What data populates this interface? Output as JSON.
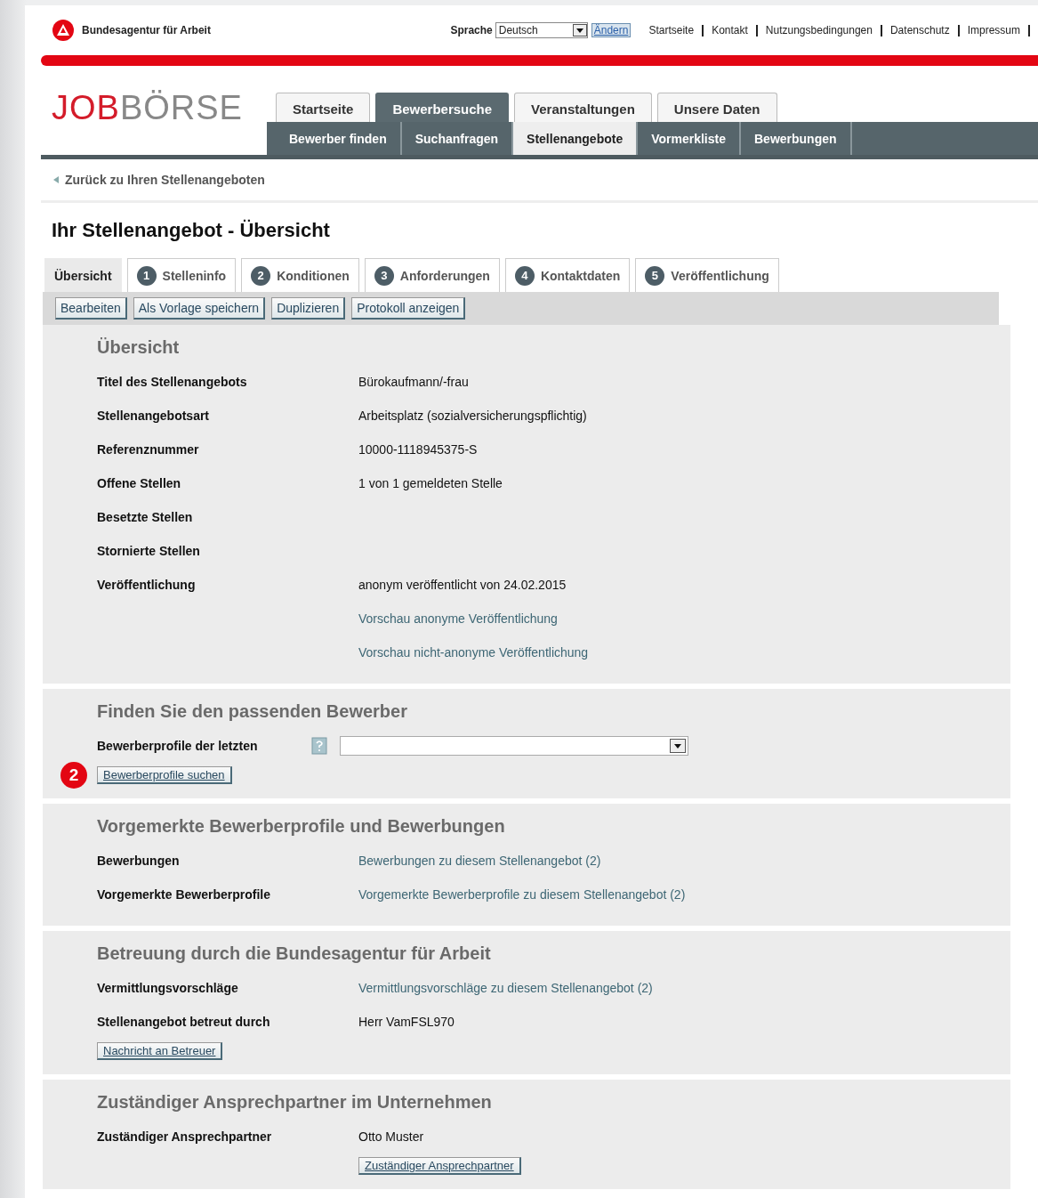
{
  "header": {
    "agency": "Bundesagentur für Arbeit",
    "language_label": "Sprache",
    "language_value": "Deutsch",
    "change_link": "Ändern",
    "top_links": [
      "Startseite",
      "Kontakt",
      "Nutzungsbedingungen",
      "Datenschutz",
      "Impressum"
    ]
  },
  "brand": {
    "part_1": "JOB",
    "part_2": "BÖRSE"
  },
  "main_tabs": [
    {
      "label": "Startseite",
      "selected": false
    },
    {
      "label": "Bewerbersuche",
      "selected": true
    },
    {
      "label": "Veranstaltungen",
      "selected": false
    },
    {
      "label": "Unsere Daten",
      "selected": false
    }
  ],
  "sub_tabs": [
    {
      "label": "Bewerber finden",
      "selected": false
    },
    {
      "label": "Suchanfragen",
      "selected": false
    },
    {
      "label": "Stellenangebote",
      "selected": true
    },
    {
      "label": "Vormerkliste",
      "selected": false
    },
    {
      "label": "Bewerbungen",
      "selected": false
    }
  ],
  "back_link": "Zurück zu Ihren Stellenangeboten",
  "page_title": "Ihr Stellenangebot - Übersicht",
  "step_tabs": [
    {
      "label": "Übersicht",
      "selected": true
    },
    {
      "number": "1",
      "label": "Stelleninfo",
      "selected": false
    },
    {
      "number": "2",
      "label": "Konditionen",
      "selected": false
    },
    {
      "number": "3",
      "label": "Anforderungen",
      "selected": false
    },
    {
      "number": "4",
      "label": "Kontaktdaten",
      "selected": false
    },
    {
      "number": "5",
      "label": "Veröffentlichung",
      "selected": false
    }
  ],
  "action_buttons": [
    "Bearbeiten",
    "Als Vorlage speichern",
    "Duplizieren",
    "Protokoll anzeigen"
  ],
  "sections": [
    {
      "title": "Übersicht",
      "rows": [
        {
          "label": "Titel des Stellenangebots",
          "kind": "text",
          "value": "Bürokaufmann/-frau"
        },
        {
          "label": "Stellenangebotsart",
          "kind": "text",
          "value": "Arbeitsplatz (sozialversicherungspflichtig)"
        },
        {
          "label": "Referenznummer",
          "kind": "text",
          "value": "10000-1118945375-S"
        },
        {
          "label": "Offene Stellen",
          "kind": "text",
          "value": "1 von 1 gemeldeten Stelle"
        },
        {
          "label": "Besetzte Stellen",
          "kind": "text"
        },
        {
          "label": "Stornierte Stellen",
          "kind": "text"
        },
        {
          "label": "Veröffentlichung",
          "kind": "text",
          "value": "anonym veröffentlicht von 24.02.2015"
        },
        {
          "kind": "link",
          "value": "Vorschau anonyme Veröffentlichung"
        },
        {
          "kind": "link",
          "value": "Vorschau nicht-anonyme Veröffentlichung"
        }
      ]
    },
    {
      "title": "Finden Sie den passenden Bewerber",
      "rows": [
        {
          "label": "Bewerberprofile der letzten",
          "kind": "select"
        }
      ],
      "button": "Bewerberprofile suchen",
      "badge": "2"
    },
    {
      "title": "Vorgemerkte Bewerberprofile und Bewerbungen",
      "rows": [
        {
          "label": "Bewerbungen",
          "kind": "link",
          "value": "Bewerbungen zu diesem Stellenangebot (2)"
        },
        {
          "label": "Vorgemerkte Bewerberprofile",
          "kind": "link",
          "value": "Vorgemerkte Bewerberprofile zu diesem Stellenangebot (2)"
        }
      ]
    },
    {
      "title": "Betreuung durch die Bundesagentur für Arbeit",
      "rows": [
        {
          "label": "Vermittlungsvorschläge",
          "kind": "link",
          "value": "Vermittlungsvorschläge zu diesem Stellenangebot (2)"
        },
        {
          "label": "Stellenangebot betreut durch",
          "kind": "text",
          "value": "Herr VamFSL970"
        }
      ],
      "button": "Nachricht an Betreuer"
    },
    {
      "title": "Zuständiger Ansprechpartner im Unternehmen",
      "rows": [
        {
          "label": "Zuständiger Ansprechpartner",
          "kind": "text",
          "value": "Otto Muster"
        }
      ],
      "value_button": "Zuständiger Ansprechpartner"
    }
  ]
}
